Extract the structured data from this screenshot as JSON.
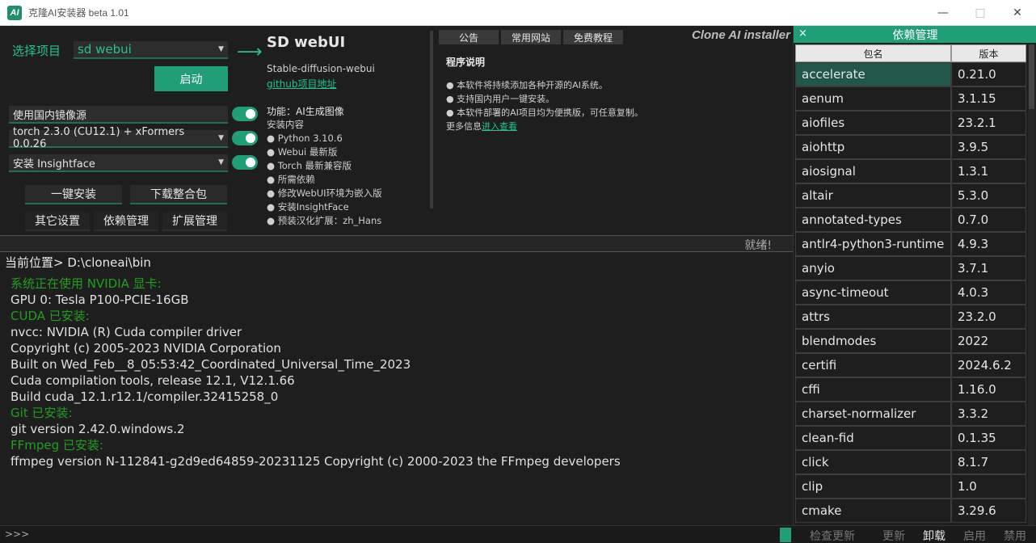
{
  "window": {
    "logo": "AI",
    "title": "克隆AI安装器 beta 1.01",
    "min_icon": "minimize-icon",
    "max_icon": "maximize-icon",
    "close_icon": "close-icon"
  },
  "controls": {
    "project_label": "选择项目",
    "project_value": "sd webui",
    "start_label": "启动",
    "mirror_label": "使用国内镜像源",
    "torch_value": "torch 2.3.0 (CU12.1) + xFormers 0.0.26",
    "insightface_value": "安装 Insightface",
    "one_click_install": "一键安装",
    "download_bundle": "下载整合包",
    "other_settings": "其它设置",
    "dep_manage": "依赖管理",
    "ext_manage": "扩展管理"
  },
  "info": {
    "title": "SD webUI",
    "subtitle": "Stable-diffusion-webui",
    "github_link": "github项目地址",
    "feature": "功能：AI生成图像",
    "install_header": "安装内容",
    "install_items": [
      "● Python 3.10.6",
      "● Webui 最新版",
      "● Torch 最新兼容版",
      "● 所需依赖",
      "● 修改WebUI环境为嵌入版",
      "● 安装InsightFace",
      "● 预装汉化扩展：zh_Hans"
    ]
  },
  "tabs": [
    "公告",
    "常用网站",
    "免费教程"
  ],
  "brand": "Clone AI installer",
  "notice": {
    "title": "程序说明",
    "items": [
      "● 本软件将持续添加各种开源的AI系统。",
      "● 支持国内用户一键安装。",
      "● 本软件部署的AI项目均为便携版，可任意复制。"
    ],
    "more_prefix": "更多信息",
    "more_link": "进入查看"
  },
  "status": "就绪!",
  "console": {
    "current_path": "当前位置> D:\\cloneai\\bin",
    "lines": [
      {
        "text": "系统正在使用 NVIDIA 显卡:",
        "color": "green"
      },
      {
        "text": "GPU 0: Tesla P100-PCIE-16GB",
        "color": "white"
      },
      {
        "text": "CUDA 已安装:",
        "color": "green"
      },
      {
        "text": "nvcc: NVIDIA (R) Cuda compiler driver",
        "color": "white"
      },
      {
        "text": "Copyright (c) 2005-2023 NVIDIA Corporation",
        "color": "white"
      },
      {
        "text": "Built on Wed_Feb__8_05:53:42_Coordinated_Universal_Time_2023",
        "color": "white"
      },
      {
        "text": "Cuda compilation tools, release 12.1, V12.1.66",
        "color": "white"
      },
      {
        "text": "Build cuda_12.1.r12.1/compiler.32415258_0",
        "color": "white"
      },
      {
        "text": "Git 已安装:",
        "color": "green"
      },
      {
        "text": "git version 2.42.0.windows.2",
        "color": "white"
      },
      {
        "text": "FFmpeg 已安装:",
        "color": "green"
      },
      {
        "text": "ffmpeg version N-112841-g2d9ed64859-20231125 Copyright (c) 2000-2023 the FFmpeg developers",
        "color": "white"
      }
    ]
  },
  "bottom": {
    "prompt": ">>>",
    "check_update": "检查更新",
    "update": "更新",
    "uninstall": "卸载",
    "enable": "启用",
    "disable": "禁用"
  },
  "deps": {
    "title": "依赖管理",
    "close": "×",
    "col_name": "包名",
    "col_version": "版本",
    "selected_index": 0,
    "rows": [
      {
        "name": "accelerate",
        "version": "0.21.0"
      },
      {
        "name": "aenum",
        "version": "3.1.15"
      },
      {
        "name": "aiofiles",
        "version": "23.2.1"
      },
      {
        "name": "aiohttp",
        "version": "3.9.5"
      },
      {
        "name": "aiosignal",
        "version": "1.3.1"
      },
      {
        "name": "altair",
        "version": "5.3.0"
      },
      {
        "name": "annotated-types",
        "version": "0.7.0"
      },
      {
        "name": "antlr4-python3-runtime",
        "version": "4.9.3"
      },
      {
        "name": "anyio",
        "version": "3.7.1"
      },
      {
        "name": "async-timeout",
        "version": "4.0.3"
      },
      {
        "name": "attrs",
        "version": "23.2.0"
      },
      {
        "name": "blendmodes",
        "version": "2022"
      },
      {
        "name": "certifi",
        "version": "2024.6.2"
      },
      {
        "name": "cffi",
        "version": "1.16.0"
      },
      {
        "name": "charset-normalizer",
        "version": "3.3.2"
      },
      {
        "name": "clean-fid",
        "version": "0.1.35"
      },
      {
        "name": "click",
        "version": "8.1.7"
      },
      {
        "name": "clip",
        "version": "1.0"
      },
      {
        "name": "cmake",
        "version": "3.29.6"
      }
    ]
  },
  "colors": {
    "accent": "#1f9e78",
    "green_text": "#1fa01f",
    "bg": "#1e1e1e"
  }
}
